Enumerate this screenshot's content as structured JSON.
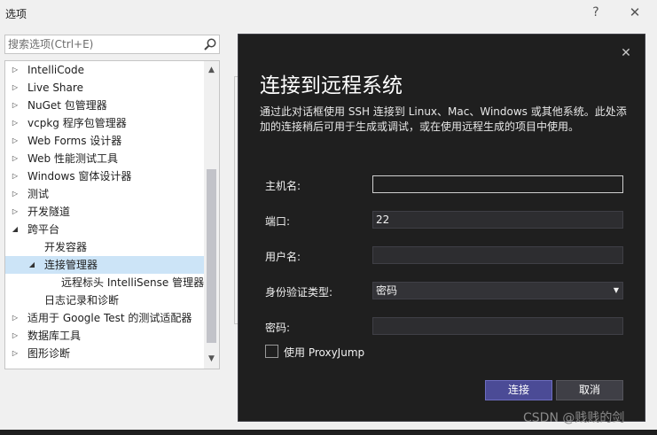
{
  "window": {
    "title": "选项",
    "help_glyph": "?",
    "close_glyph": "✕"
  },
  "search": {
    "placeholder": "搜索选项(Ctrl+E)"
  },
  "tree": {
    "items": [
      {
        "label": "IntelliCode",
        "level": 0,
        "expanded": false,
        "has_children": true
      },
      {
        "label": "Live Share",
        "level": 0,
        "expanded": false,
        "has_children": true
      },
      {
        "label": "NuGet 包管理器",
        "level": 0,
        "expanded": false,
        "has_children": true
      },
      {
        "label": "vcpkg 程序包管理器",
        "level": 0,
        "expanded": false,
        "has_children": true
      },
      {
        "label": "Web Forms 设计器",
        "level": 0,
        "expanded": false,
        "has_children": true
      },
      {
        "label": "Web 性能测试工具",
        "level": 0,
        "expanded": false,
        "has_children": true
      },
      {
        "label": "Windows 窗体设计器",
        "level": 0,
        "expanded": false,
        "has_children": true
      },
      {
        "label": "测试",
        "level": 0,
        "expanded": false,
        "has_children": true
      },
      {
        "label": "开发隧道",
        "level": 0,
        "expanded": false,
        "has_children": true
      },
      {
        "label": "跨平台",
        "level": 0,
        "expanded": true,
        "has_children": true
      },
      {
        "label": "开发容器",
        "level": 1,
        "expanded": false,
        "has_children": false
      },
      {
        "label": "连接管理器",
        "level": 1,
        "expanded": true,
        "has_children": true,
        "selected": true
      },
      {
        "label": "远程标头 IntelliSense 管理器",
        "level": 2,
        "expanded": false,
        "has_children": false
      },
      {
        "label": "日志记录和诊断",
        "level": 1,
        "expanded": false,
        "has_children": false
      },
      {
        "label": "适用于 Google Test 的测试适配器",
        "level": 0,
        "expanded": false,
        "has_children": true
      },
      {
        "label": "数据库工具",
        "level": 0,
        "expanded": false,
        "has_children": true
      },
      {
        "label": "图形诊断",
        "level": 0,
        "expanded": false,
        "has_children": true
      }
    ]
  },
  "dialog": {
    "title": "连接到远程系统",
    "description": "通过此对话框使用 SSH 连接到 Linux、Mac、Windows 或其他系统。此处添加的连接稍后可用于生成或调试，或在使用远程生成的项目中使用。",
    "close_glyph": "✕",
    "fields": {
      "host": {
        "label": "主机名:",
        "value": ""
      },
      "port": {
        "label": "端口:",
        "value": "22"
      },
      "user": {
        "label": "用户名:",
        "value": ""
      },
      "auth": {
        "label": "身份验证类型:",
        "value": "密码"
      },
      "password": {
        "label": "密码:",
        "value": ""
      }
    },
    "proxyjump": {
      "label": "使用 ProxyJump",
      "checked": false
    },
    "connect_label": "连接",
    "cancel_label": "取消"
  },
  "watermark": "CSDN @贱贱的剑"
}
